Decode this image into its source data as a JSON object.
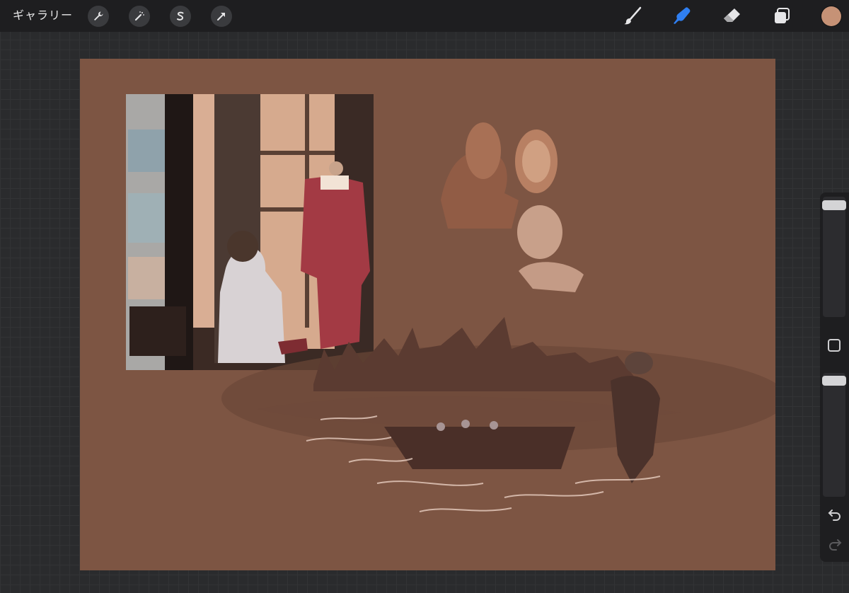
{
  "topbar": {
    "gallery_label": "ギャラリー",
    "left_tools": [
      {
        "icon": "wrench-icon",
        "name": "actions"
      },
      {
        "icon": "magic-wand-icon",
        "name": "adjustments"
      },
      {
        "icon": "selection-s-icon",
        "name": "selection"
      },
      {
        "icon": "arrow-cursor-icon",
        "name": "transform"
      }
    ],
    "right_tools": [
      {
        "icon": "brush-icon",
        "name": "paint",
        "active": false
      },
      {
        "icon": "smudge-icon",
        "name": "smudge",
        "active": true
      },
      {
        "icon": "eraser-icon",
        "name": "erase",
        "active": false
      },
      {
        "icon": "layers-icon",
        "name": "layers",
        "active": false
      }
    ],
    "current_color": "#c69276",
    "active_color": "#2f7ff2"
  },
  "canvas": {
    "background_color": "#7d5543"
  },
  "sidebar": {
    "brush_size_level": 0.1,
    "opacity_level": 0.05,
    "modify_icon": "square-icon",
    "undo_icon": "undo-icon",
    "redo_icon": "redo-icon"
  }
}
